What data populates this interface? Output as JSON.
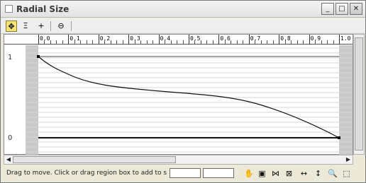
{
  "window": {
    "title": "Radial Size",
    "buttons": {
      "minimize": "_",
      "maximize": "□",
      "close": "✕"
    }
  },
  "toolbar": {
    "tools": [
      {
        "name": "move-keys",
        "icon": "✥",
        "active": true
      },
      {
        "name": "scale-keys",
        "icon": "Ξ"
      },
      {
        "name": "insert-point",
        "icon": "+"
      },
      {
        "name": "delete-point",
        "icon": "⊖"
      }
    ]
  },
  "ruler": {
    "labels": [
      "0.0",
      "0.1",
      "0.2",
      "0.3",
      "0.4",
      "0.5",
      "0.6",
      "0.7",
      "0.8",
      "0.9",
      "1.0"
    ]
  },
  "graph": {
    "y_top_label": "1",
    "y_bottom_label": "0"
  },
  "status": {
    "text": "Drag to move. Click or drag region box to add to se",
    "field1": "",
    "field2": ""
  },
  "nav_icons": [
    "pan-icon",
    "zoom-extents-icon",
    "zoom-horizontal-extents-icon",
    "zoom-value-extents-icon",
    "zoom-horizontal-icon",
    "zoom-vertical-icon",
    "zoom-icon",
    "zoom-region-icon"
  ]
}
